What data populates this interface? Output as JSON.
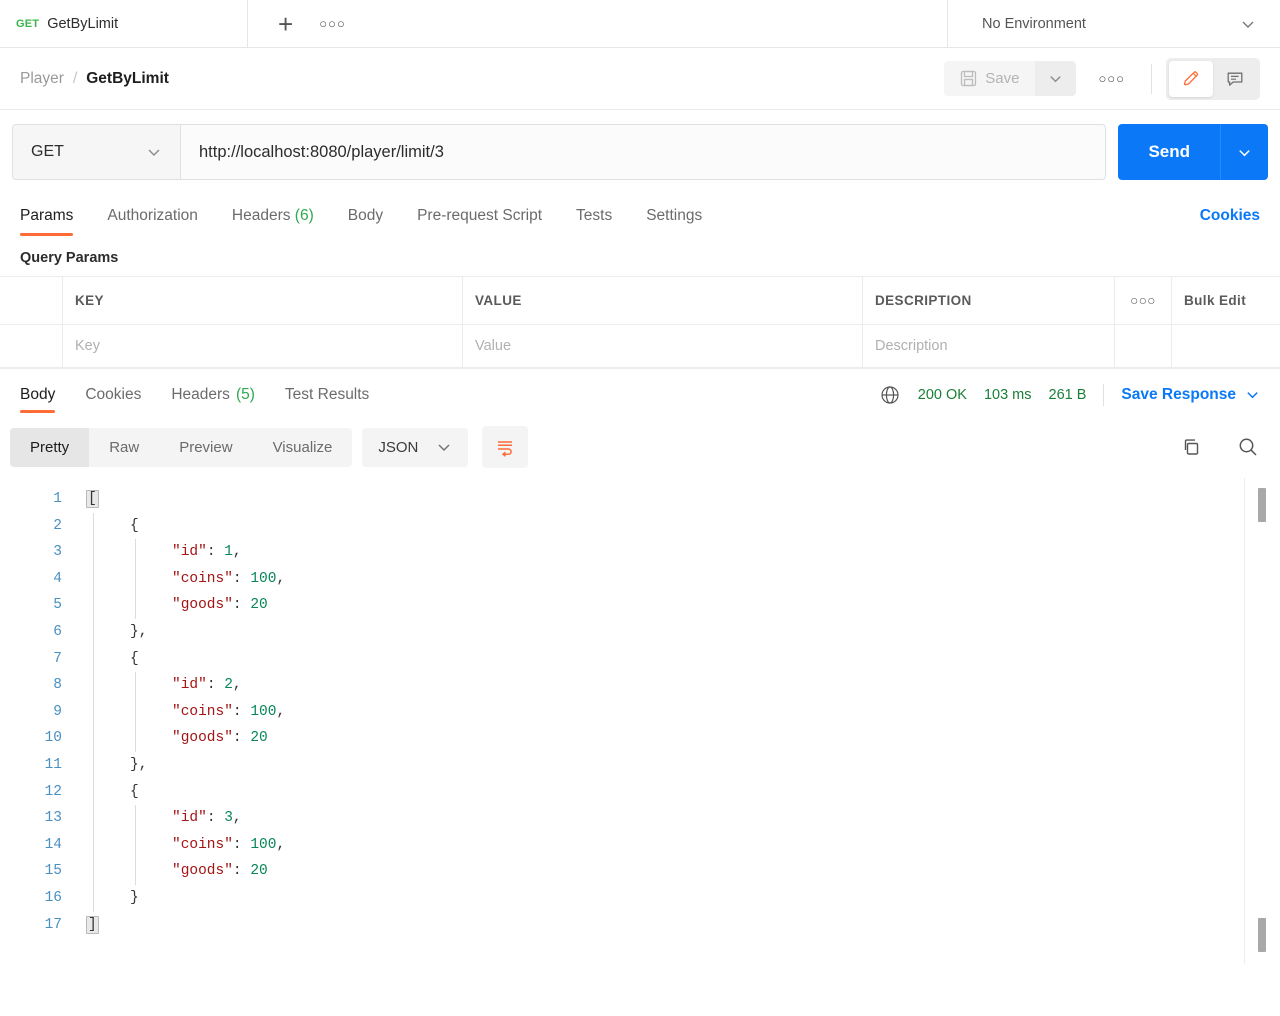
{
  "tabstrip": {
    "request_tab": {
      "method": "GET",
      "name": "GetByLimit"
    },
    "new_tab_label": "+",
    "tab_menu_label": "○○○",
    "environment": {
      "selected": "No Environment",
      "caret": "⌄"
    }
  },
  "header": {
    "breadcrumb": {
      "parent": "Player",
      "separator": "/",
      "current": "GetByLimit"
    },
    "save_label": "Save",
    "save_caret": "⌄",
    "more_label": "○○○",
    "edit_icon_name": "pencil-icon",
    "comment_icon_name": "comment-icon"
  },
  "url_bar": {
    "method": "GET",
    "method_caret": "⌄",
    "url": "http://localhost:8080/player/limit/3",
    "send_label": "Send",
    "send_caret": "⌄"
  },
  "request_tabs": {
    "items": [
      {
        "label": "Params",
        "count": "",
        "active": true
      },
      {
        "label": "Authorization",
        "count": "",
        "active": false
      },
      {
        "label": "Headers",
        "count": "(6)",
        "active": false
      },
      {
        "label": "Body",
        "count": "",
        "active": false
      },
      {
        "label": "Pre-request Script",
        "count": "",
        "active": false
      },
      {
        "label": "Tests",
        "count": "",
        "active": false
      },
      {
        "label": "Settings",
        "count": "",
        "active": false
      }
    ],
    "cookies_link": "Cookies"
  },
  "query_params": {
    "section_title": "Query Params",
    "columns": [
      "KEY",
      "VALUE",
      "DESCRIPTION"
    ],
    "row_menu_label": "○○○",
    "bulk_edit_label": "Bulk Edit",
    "rows": [
      {
        "key_placeholder": "Key",
        "value_placeholder": "Value",
        "description_placeholder": "Description"
      }
    ]
  },
  "response": {
    "tabs": [
      {
        "label": "Body",
        "count": "",
        "active": true
      },
      {
        "label": "Cookies",
        "count": "",
        "active": false
      },
      {
        "label": "Headers",
        "count": "(5)",
        "active": false
      },
      {
        "label": "Test Results",
        "count": "",
        "active": false
      }
    ],
    "globe_icon_name": "globe-icon",
    "status": "200 OK",
    "time": "103 ms",
    "size": "261 B",
    "save_response_label": "Save Response",
    "save_response_caret": "⌄",
    "view_modes": [
      {
        "label": "Pretty",
        "active": true
      },
      {
        "label": "Raw",
        "active": false
      },
      {
        "label": "Preview",
        "active": false
      },
      {
        "label": "Visualize",
        "active": false
      }
    ],
    "format": {
      "selected": "JSON",
      "caret": "⌄"
    },
    "wrap_icon_name": "wrap-lines-icon",
    "copy_icon_name": "copy-icon",
    "search_icon_name": "search-icon"
  },
  "body_code": {
    "language": "json",
    "line_numbers": [
      "1",
      "2",
      "3",
      "4",
      "5",
      "6",
      "7",
      "8",
      "9",
      "10",
      "11",
      "12",
      "13",
      "14",
      "15",
      "16",
      "17"
    ],
    "lines": [
      {
        "n": 1,
        "indent": 0,
        "tokens": [
          {
            "t": "[",
            "c": "p",
            "bracket": true
          }
        ]
      },
      {
        "n": 2,
        "indent": 1,
        "tokens": [
          {
            "t": "{",
            "c": "p"
          }
        ]
      },
      {
        "n": 3,
        "indent": 2,
        "tokens": [
          {
            "t": "\"id\"",
            "c": "k"
          },
          {
            "t": ": ",
            "c": "p"
          },
          {
            "t": "1",
            "c": "n"
          },
          {
            "t": ",",
            "c": "p"
          }
        ]
      },
      {
        "n": 4,
        "indent": 2,
        "tokens": [
          {
            "t": "\"coins\"",
            "c": "k"
          },
          {
            "t": ": ",
            "c": "p"
          },
          {
            "t": "100",
            "c": "n"
          },
          {
            "t": ",",
            "c": "p"
          }
        ]
      },
      {
        "n": 5,
        "indent": 2,
        "tokens": [
          {
            "t": "\"goods\"",
            "c": "k"
          },
          {
            "t": ": ",
            "c": "p"
          },
          {
            "t": "20",
            "c": "n"
          }
        ]
      },
      {
        "n": 6,
        "indent": 1,
        "tokens": [
          {
            "t": "},",
            "c": "p"
          }
        ]
      },
      {
        "n": 7,
        "indent": 1,
        "tokens": [
          {
            "t": "{",
            "c": "p"
          }
        ]
      },
      {
        "n": 8,
        "indent": 2,
        "tokens": [
          {
            "t": "\"id\"",
            "c": "k"
          },
          {
            "t": ": ",
            "c": "p"
          },
          {
            "t": "2",
            "c": "n"
          },
          {
            "t": ",",
            "c": "p"
          }
        ]
      },
      {
        "n": 9,
        "indent": 2,
        "tokens": [
          {
            "t": "\"coins\"",
            "c": "k"
          },
          {
            "t": ": ",
            "c": "p"
          },
          {
            "t": "100",
            "c": "n"
          },
          {
            "t": ",",
            "c": "p"
          }
        ]
      },
      {
        "n": 10,
        "indent": 2,
        "tokens": [
          {
            "t": "\"goods\"",
            "c": "k"
          },
          {
            "t": ": ",
            "c": "p"
          },
          {
            "t": "20",
            "c": "n"
          }
        ]
      },
      {
        "n": 11,
        "indent": 1,
        "tokens": [
          {
            "t": "},",
            "c": "p"
          }
        ]
      },
      {
        "n": 12,
        "indent": 1,
        "tokens": [
          {
            "t": "{",
            "c": "p"
          }
        ]
      },
      {
        "n": 13,
        "indent": 2,
        "tokens": [
          {
            "t": "\"id\"",
            "c": "k"
          },
          {
            "t": ": ",
            "c": "p"
          },
          {
            "t": "3",
            "c": "n"
          },
          {
            "t": ",",
            "c": "p"
          }
        ]
      },
      {
        "n": 14,
        "indent": 2,
        "tokens": [
          {
            "t": "\"coins\"",
            "c": "k"
          },
          {
            "t": ": ",
            "c": "p"
          },
          {
            "t": "100",
            "c": "n"
          },
          {
            "t": ",",
            "c": "p"
          }
        ]
      },
      {
        "n": 15,
        "indent": 2,
        "tokens": [
          {
            "t": "\"goods\"",
            "c": "k"
          },
          {
            "t": ": ",
            "c": "p"
          },
          {
            "t": "20",
            "c": "n"
          }
        ]
      },
      {
        "n": 16,
        "indent": 1,
        "tokens": [
          {
            "t": "}",
            "c": "p"
          }
        ]
      },
      {
        "n": 17,
        "indent": 0,
        "tokens": [
          {
            "t": "]",
            "c": "p",
            "bracket": true
          }
        ]
      }
    ],
    "payload": [
      {
        "id": 1,
        "coins": 100,
        "goods": 20
      },
      {
        "id": 2,
        "coins": 100,
        "goods": 20
      },
      {
        "id": 3,
        "coins": 100,
        "goods": 20
      }
    ]
  },
  "colors": {
    "accent_orange": "#ff6c37",
    "link_blue": "#0b79f7",
    "success_green": "#1a7f37",
    "method_green": "#3bb54a",
    "json_key": "#a31515",
    "json_number": "#098658",
    "line_number": "#4a90c2"
  }
}
